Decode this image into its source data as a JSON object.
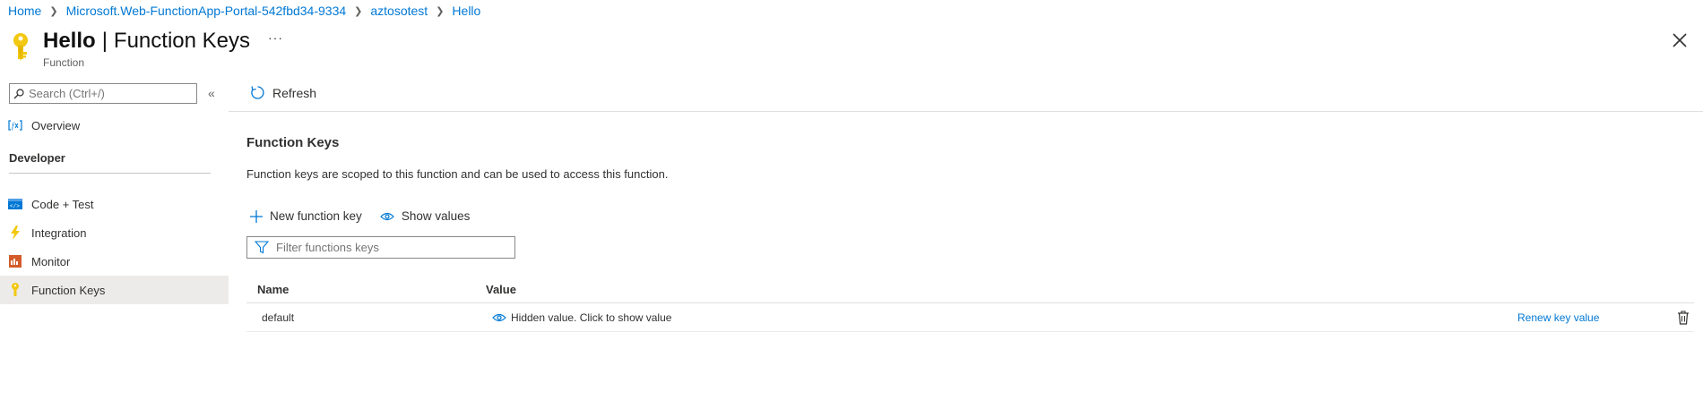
{
  "breadcrumb": [
    {
      "label": "Home"
    },
    {
      "label": "Microsoft.Web-FunctionApp-Portal-542fbd34-9334"
    },
    {
      "label": "aztosotest"
    },
    {
      "label": "Hello"
    }
  ],
  "header": {
    "title": "Hello",
    "separator": "|",
    "blade_title": "Function Keys",
    "subtitle": "Function",
    "more_label": "···",
    "icon": "key-icon"
  },
  "sidebar": {
    "search_placeholder": "Search (Ctrl+/)",
    "collapse_label": "«",
    "items": [
      {
        "label": "Overview",
        "icon": "function-icon"
      },
      {
        "label": "Code + Test",
        "icon": "code-icon"
      },
      {
        "label": "Integration",
        "icon": "lightning-icon"
      },
      {
        "label": "Monitor",
        "icon": "monitor-icon"
      },
      {
        "label": "Function Keys",
        "icon": "key-icon",
        "selected": true
      }
    ],
    "group_label": "Developer"
  },
  "toolbar": {
    "refresh_label": "Refresh"
  },
  "content": {
    "section_title": "Function Keys",
    "description": "Function keys are scoped to this function and can be used to access this function.",
    "new_key_label": "New function key",
    "show_values_label": "Show values",
    "filter_placeholder": "Filter functions keys",
    "columns": {
      "name": "Name",
      "value": "Value"
    },
    "rows": [
      {
        "name": "default",
        "value": "Hidden value. Click to show value",
        "action": "Renew key value"
      }
    ]
  },
  "colors": {
    "accent": "#0078d4",
    "key_yellow": "#f2c811",
    "selected_bg": "#edebe9"
  }
}
